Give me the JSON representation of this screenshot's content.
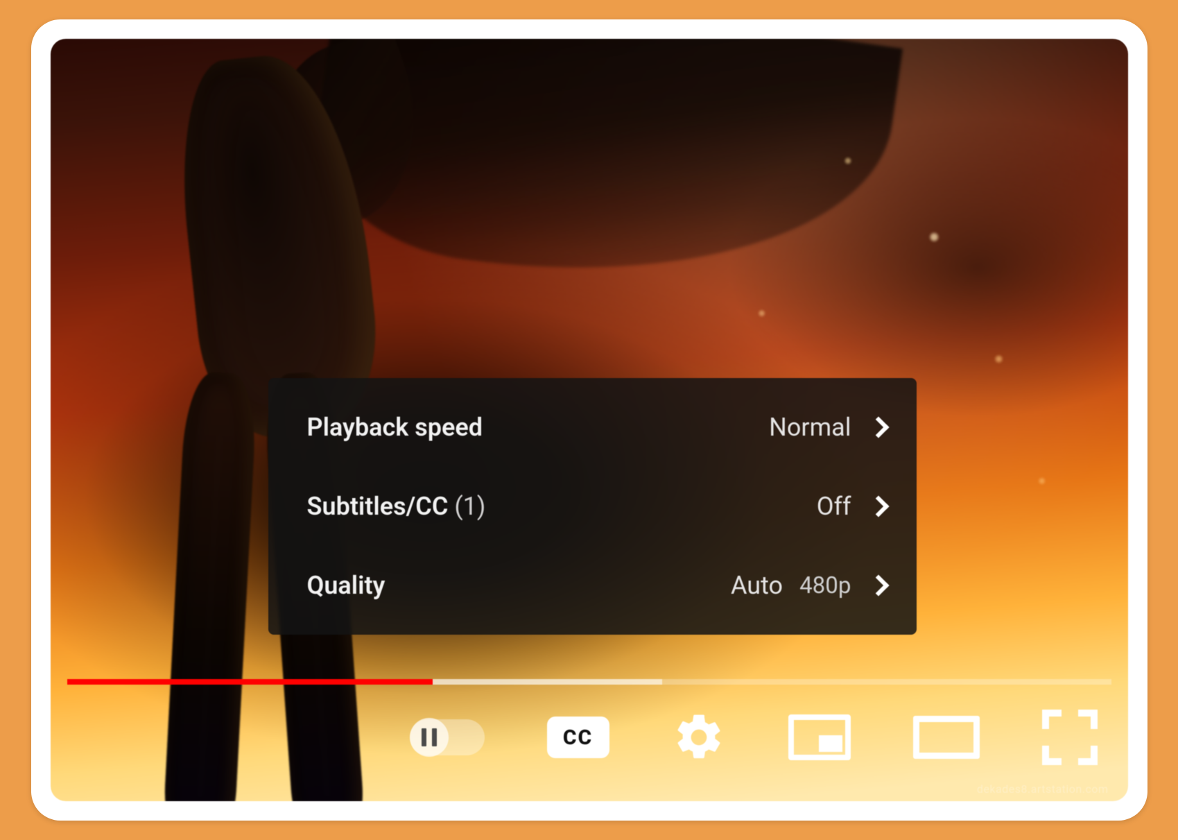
{
  "colors": {
    "page_bg": "#ed9d4a",
    "card_bg": "#ffffff",
    "menu_bg": "rgba(20,20,20,0.86)",
    "played": "#ff0000"
  },
  "progress": {
    "played_percent": 35,
    "buffered_percent": 57
  },
  "settings_menu": {
    "playback_speed": {
      "label": "Playback speed",
      "value": "Normal"
    },
    "subtitles": {
      "label": "Subtitles/CC",
      "count_suffix": "(1)",
      "value": "Off"
    },
    "quality": {
      "label": "Quality",
      "value": "Auto",
      "secondary": "480p"
    }
  },
  "controls": {
    "autoplay_state": "paused",
    "cc_label": "CC"
  },
  "watermark": "dekades8.artstation.com"
}
